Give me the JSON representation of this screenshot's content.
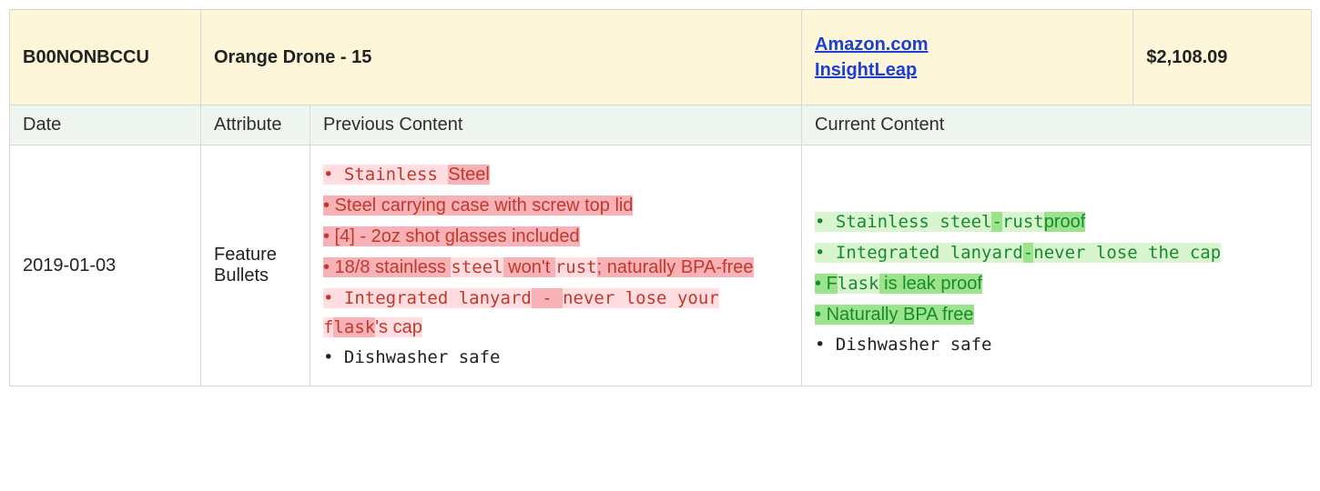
{
  "header": {
    "sku": "B00NONBCCU",
    "product": "Orange Drone - 15",
    "link1": "Amazon.com",
    "link2": "InsightLeap",
    "price": "$2,108.09"
  },
  "subheader": {
    "date": "Date",
    "attribute": "Attribute",
    "previous": "Previous Content",
    "current": "Current Content"
  },
  "row": {
    "date": "2019-01-03",
    "attribute": "Feature Bullets",
    "prev": {
      "l1a": "• Stainless ",
      "l1b": "Steel",
      "l2": "• Steel carrying case with screw top lid",
      "l3": "• [4] - 2oz shot glasses included",
      "l4a": "• 18/8 stainless ",
      "l4b": "steel",
      "l4c": " won't ",
      "l4d": "rust",
      "l4e": "; naturally BPA-free",
      "l5a": "• Integrated lanyard",
      "l5b": " - ",
      "l5c": "never lose your f",
      "l5d": "lask",
      "l5e": "'s cap",
      "l6": "• Dishwasher safe"
    },
    "curr": {
      "l1a": "• Stainless steel",
      "l1b": "-",
      "l1c": "rust",
      "l1d": "proof",
      "l2a": "• Integrated lanyard",
      "l2b": "-",
      "l2c": "never lose the cap",
      "l3a": "• F",
      "l3b": "lask",
      "l3c": " is leak proof",
      "l4": "• Naturally BPA free",
      "l5": "• Dishwasher safe"
    }
  }
}
